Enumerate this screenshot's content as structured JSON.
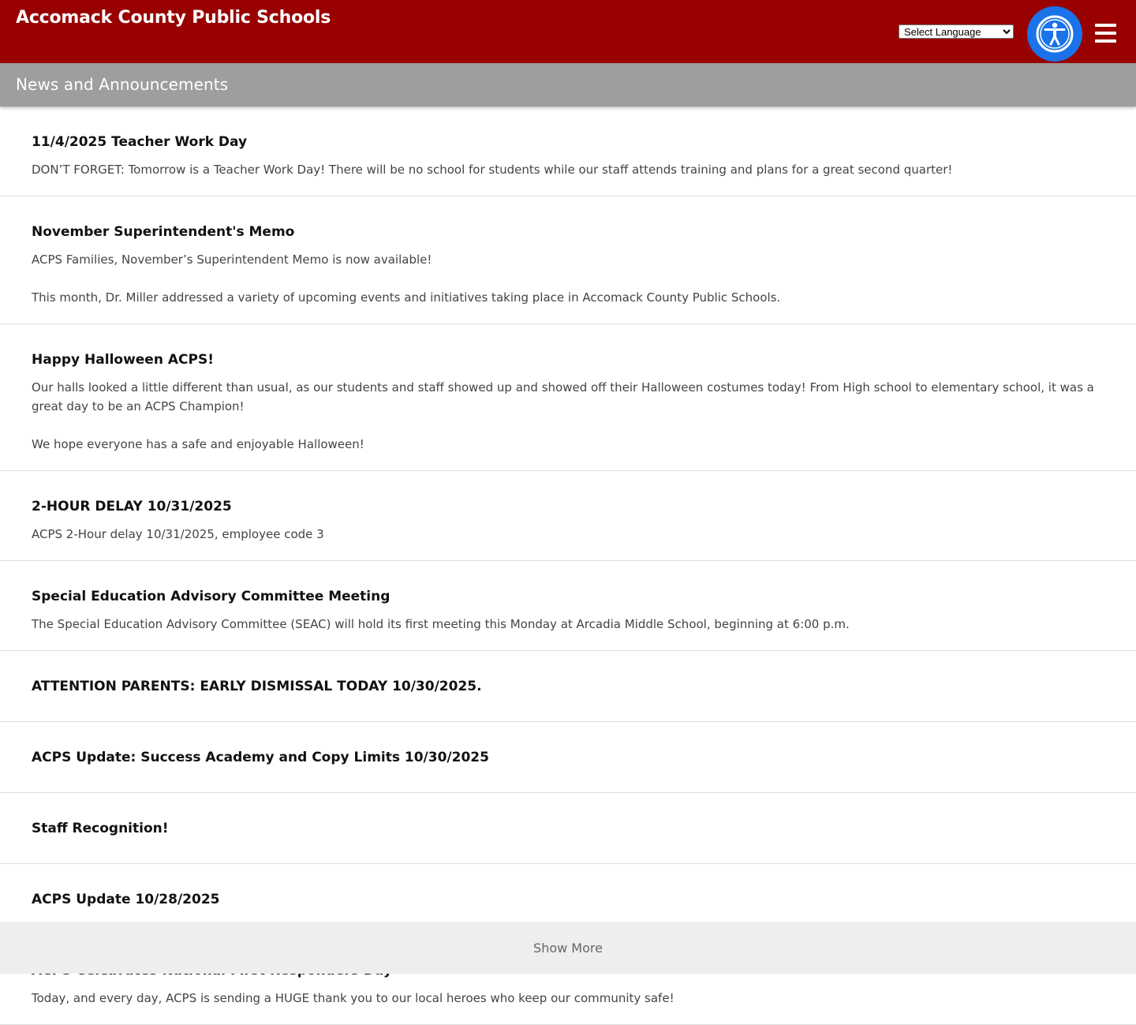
{
  "header": {
    "site_title": "Accomack County Public Schools",
    "language_select": "Select Language",
    "accessibility_icon": "accessibility-person-icon",
    "menu_icon": "hamburger-menu-icon",
    "brand_color": "#990000"
  },
  "section": {
    "title": "News and Announcements"
  },
  "news": [
    {
      "title": "11/4/2025 Teacher Work Day",
      "body": [
        "DON’T FORGET: Tomorrow is a Teacher Work Day! There will be no school for students while our staff attends training and plans for a great second quarter!"
      ]
    },
    {
      "title": "November Superintendent's Memo",
      "body": [
        "ACPS Families, November’s Superintendent Memo is now available!",
        "This month, Dr. Miller addressed a variety of upcoming events and initiatives taking place in Accomack County Public Schools."
      ]
    },
    {
      "title": "Happy Halloween ACPS!",
      "body": [
        "Our halls looked a little different than usual, as our students and staff showed up and showed off their Halloween costumes today! From High school to elementary school, it was a great day to be an ACPS Champion!",
        "We hope everyone has a safe and enjoyable Halloween!"
      ]
    },
    {
      "title": "2-HOUR DELAY 10/31/2025",
      "body": [
        "ACPS 2-Hour delay 10/31/2025, employee code 3"
      ]
    },
    {
      "title": "Special Education Advisory Committee Meeting",
      "body": [
        "The Special Education Advisory Committee (SEAC) will hold its first meeting this Monday at Arcadia Middle School, beginning at 6:00 p.m."
      ]
    },
    {
      "title": "ATTENTION PARENTS: EARLY DISMISSAL TODAY 10/30/2025.",
      "body": []
    },
    {
      "title": "ACPS Update: Success Academy and Copy Limits 10/30/2025",
      "body": []
    },
    {
      "title": "Staff Recognition!",
      "body": []
    },
    {
      "title": "ACPS Update 10/28/2025",
      "body": []
    },
    {
      "title": "ACPS Celebrates National First Responders Day",
      "body": [
        "Today, and every day, ACPS is sending a HUGE thank you to our local heroes who keep our community safe!"
      ]
    }
  ],
  "show_more_label": "Show More"
}
